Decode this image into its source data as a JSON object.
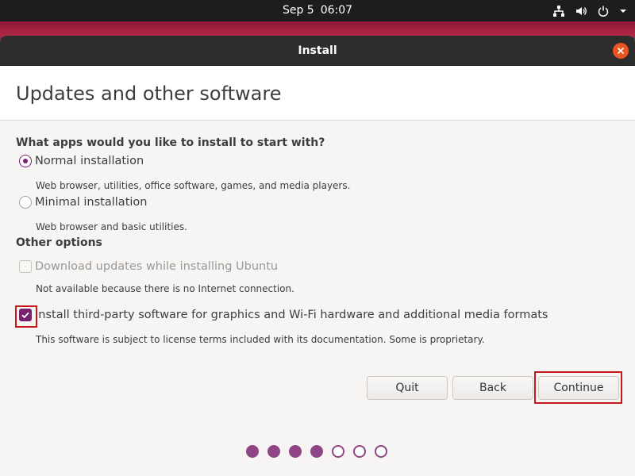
{
  "topbar": {
    "date": "Sep 5",
    "time": "06:07",
    "icons": [
      "network-icon",
      "volume-icon",
      "power-icon",
      "menu-arrow-icon"
    ]
  },
  "window": {
    "title": "Install",
    "close_icon": "close-icon"
  },
  "page": {
    "heading": "Updates and other software"
  },
  "apps_section": {
    "question": "What apps would you like to install to start with?",
    "options": [
      {
        "label": "Normal installation",
        "description": "Web browser, utilities, office software, games, and media players.",
        "selected": true
      },
      {
        "label": "Minimal installation",
        "description": "Web browser and basic utilities.",
        "selected": false
      }
    ]
  },
  "other_options": {
    "heading": "Other options",
    "download_updates": {
      "label": "Download updates while installing Ubuntu",
      "description": "Not available because there is no Internet connection.",
      "checked": false,
      "disabled": true
    },
    "third_party": {
      "label": "Install third-party software for graphics and Wi-Fi hardware and additional media formats",
      "description": "This software is subject to license terms included with its documentation. Some is proprietary.",
      "checked": true
    }
  },
  "buttons": {
    "quit": "Quit",
    "back": "Back",
    "continue": "Continue"
  },
  "progress": {
    "total_steps": 7,
    "completed_steps": 4
  },
  "colors": {
    "accent": "#77216f",
    "highlight": "#c4181d",
    "close": "#e9541f"
  }
}
